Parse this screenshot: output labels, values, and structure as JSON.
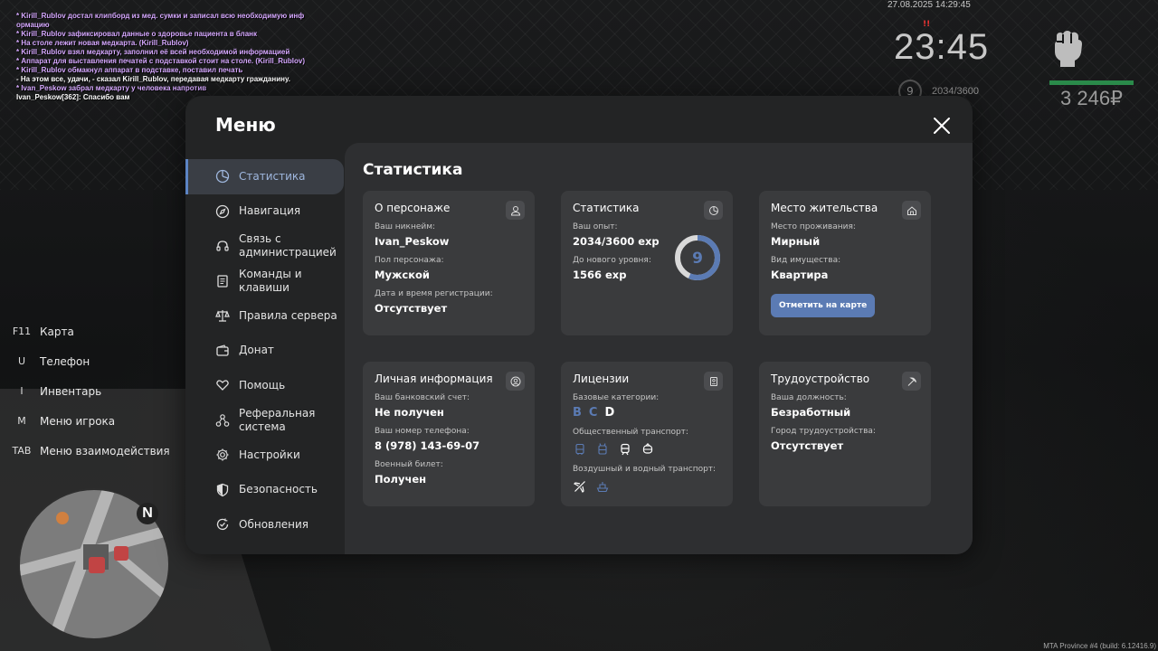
{
  "chat": [
    {
      "text": "* Kirill_Rublov достал клипборд из мед. сумки и записал всю необходимую инф ормацию",
      "color": "#d6a8ff"
    },
    {
      "text": "* Kirill_Rublov зафиксировал данные о здоровье пациента в бланк",
      "color": "#d6a8ff"
    },
    {
      "text": "* На столе лежит новая медкарта. (Kirill_Rublov)",
      "color": "#d6a8ff"
    },
    {
      "text": "* Kirill_Rublov взял медкарту, заполнил её всей необходимой информацией",
      "color": "#d6a8ff"
    },
    {
      "text": "* Аппарат для выставления печатей с подставкой стоит на столе. (Kirill_Rublov)",
      "color": "#d6a8ff"
    },
    {
      "text": "* Kirill_Rublov обмакнул аппарат в подставке, поставил печать",
      "color": "#d6a8ff"
    },
    {
      "text": "- На этом все, удачи, - сказал Kirill_Rublov, передавая медкарту гражданину.",
      "color": "#ffffff"
    },
    {
      "text": "* Ivan_Peskow забрал медкарту у человека напротив",
      "color": "#d6a8ff"
    },
    {
      "text": "Ivan_Peskow[362]: Спасибо вам",
      "color": "#ffffff"
    }
  ],
  "hud": {
    "date": "27.08.2025 14:29:45",
    "time": "23:45",
    "alert": "!!",
    "level": "9",
    "exp": "2034/3600",
    "money": "3 246₽"
  },
  "hotkeys": [
    {
      "key": "F11",
      "label": "Карта"
    },
    {
      "key": "U",
      "label": "Телефон"
    },
    {
      "key": "I",
      "label": "Инвентарь"
    },
    {
      "key": "M",
      "label": "Меню игрока"
    },
    {
      "key": "TAB",
      "label": "Меню взаимодействия"
    }
  ],
  "minimap": {
    "north": "N"
  },
  "build": "MTA Province #4 (build: 6.12416.9)",
  "menu": {
    "title": "Меню",
    "sidebar": [
      {
        "label": "Статистика",
        "icon": "pie-chart-icon",
        "active": true
      },
      {
        "label": "Навигация",
        "icon": "compass-icon"
      },
      {
        "label": "Связь с администрацией",
        "icon": "headset-icon"
      },
      {
        "label": "Команды и клавиши",
        "icon": "document-icon"
      },
      {
        "label": "Правила сервера",
        "icon": "scales-icon"
      },
      {
        "label": "Донат",
        "icon": "wallet-icon"
      },
      {
        "label": "Помощь",
        "icon": "heart-hands-icon"
      },
      {
        "label": "Реферальная система",
        "icon": "network-icon"
      },
      {
        "label": "Настройки",
        "icon": "gear-icon"
      },
      {
        "label": "Безопасность",
        "icon": "shield-icon"
      },
      {
        "label": "Обновления",
        "icon": "refresh-check-icon"
      }
    ],
    "content_title": "Статистика",
    "cards": {
      "character": {
        "title": "О персонаже",
        "nickname_label": "Ваш никнейм:",
        "nickname": "Ivan_Peskow",
        "gender_label": "Пол персонажа:",
        "gender": "Мужской",
        "reg_label": "Дата и время регистрации:",
        "reg": "Отсутствует"
      },
      "stats": {
        "title": "Статистика",
        "exp_label": "Ваш опыт:",
        "exp": "2034/3600 exp",
        "next_label": "До нового уровня:",
        "next": "1566 exp",
        "level": "9",
        "progress": 0.565
      },
      "residence": {
        "title": "Место жительства",
        "place_label": "Место проживания:",
        "place": "Мирный",
        "property_label": "Вид имущества:",
        "property": "Квартира",
        "button": "Отметить на карте"
      },
      "personal": {
        "title": "Личная информация",
        "bank_label": "Ваш банковский счет:",
        "bank": "Не получен",
        "phone_label": "Ваш номер телефона:",
        "phone": "8 (978) 143-69-07",
        "military_label": "Военный билет:",
        "military": "Получен"
      },
      "licenses": {
        "title": "Лицензии",
        "base_label": "Базовые категории:",
        "categories": [
          {
            "letter": "B",
            "color": "#5b7bb4"
          },
          {
            "letter": "C",
            "color": "#5b7bb4"
          },
          {
            "letter": "D",
            "color": "#ffffff"
          }
        ],
        "public_label": "Общественный транспорт:",
        "air_label": "Воздушный и водный транспорт:"
      },
      "job": {
        "title": "Трудоустройство",
        "position_label": "Ваша должность:",
        "position": "Безработный",
        "city_label": "Город трудоустройства:",
        "city": "Отсутствует"
      }
    }
  }
}
